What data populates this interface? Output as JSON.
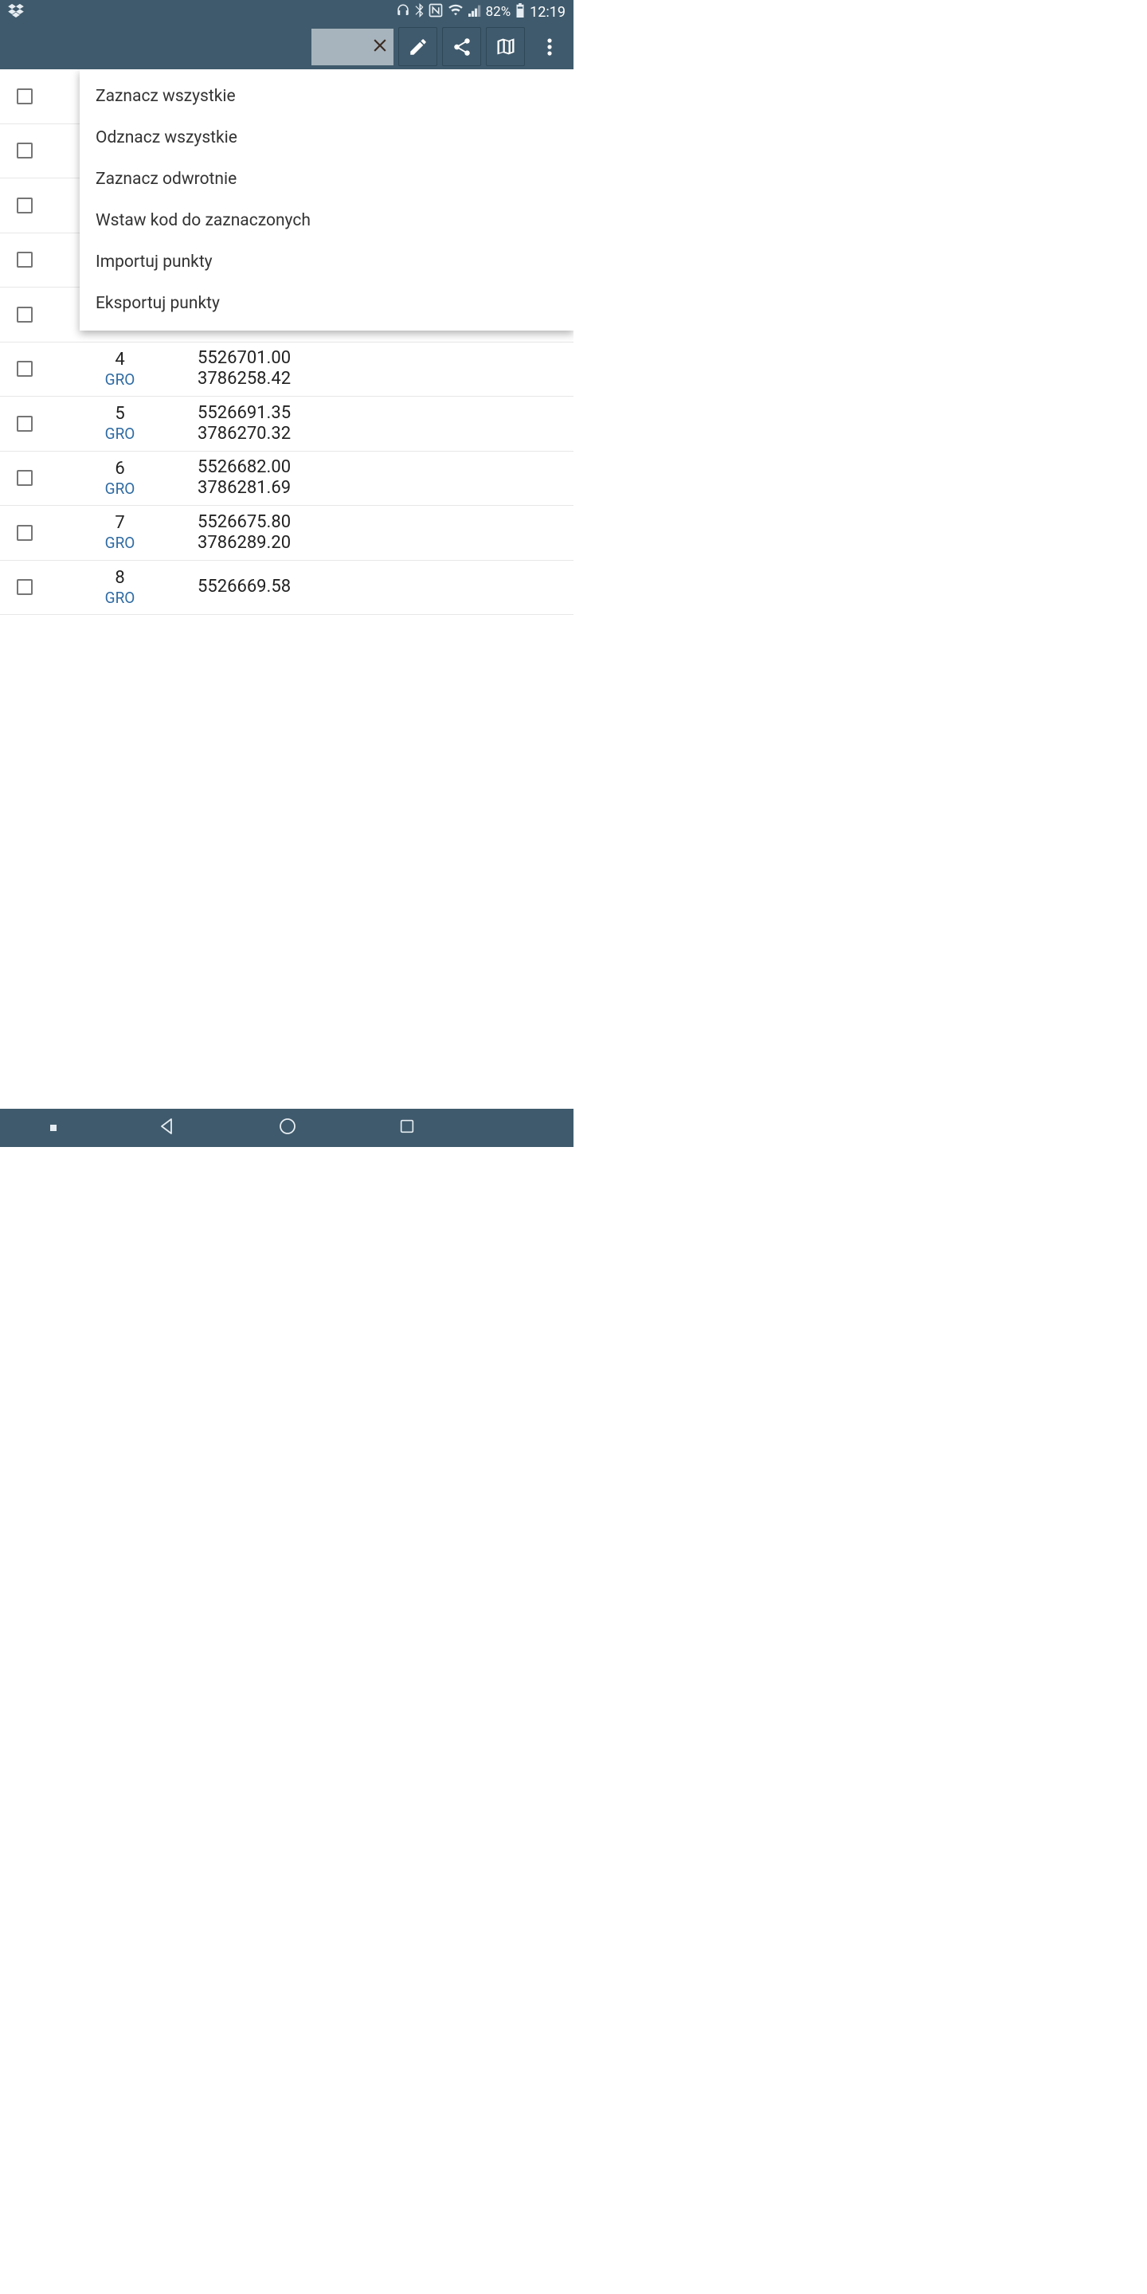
{
  "status": {
    "battery": "82%",
    "time": "12:19"
  },
  "menu": {
    "items": [
      "Zaznacz wszystkie",
      "Odznacz wszystkie",
      "Zaznacz odwrotnie",
      "Wstaw kod do zaznaczonych",
      "Importuj punkty",
      "Eksportuj punkty"
    ]
  },
  "code_label": "GRO",
  "rows": [
    {
      "num": "",
      "c1": "",
      "c2": ""
    },
    {
      "num": "",
      "c1": "",
      "c2": ""
    },
    {
      "num": "",
      "c1": "",
      "c2": ""
    },
    {
      "num": "",
      "c1": "",
      "c2": ""
    },
    {
      "num": "",
      "c1": "",
      "c2": ""
    },
    {
      "num": "4",
      "c1": "5526701.00",
      "c2": "3786258.42"
    },
    {
      "num": "5",
      "c1": "5526691.35",
      "c2": "3786270.32"
    },
    {
      "num": "6",
      "c1": "5526682.00",
      "c2": "3786281.69"
    },
    {
      "num": "7",
      "c1": "5526675.80",
      "c2": "3786289.20"
    },
    {
      "num": "8",
      "c1": "5526669.58",
      "c2": ""
    }
  ]
}
